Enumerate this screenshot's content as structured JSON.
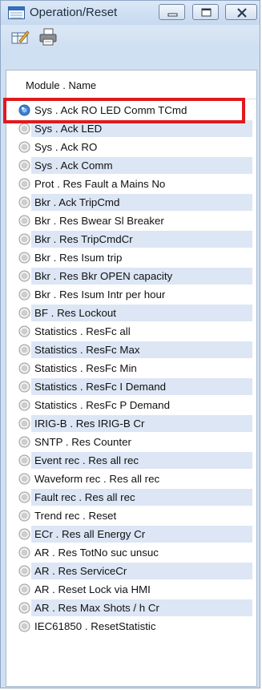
{
  "window": {
    "title": "Operation/Reset"
  },
  "colors": {
    "highlight": "#e0191e",
    "row_band": "#dce6f5",
    "selected_radio": "#3c7fd0"
  },
  "list": {
    "header": "Module . Name",
    "items": [
      "Sys . Ack RO LED Comm TCmd",
      "Sys . Ack LED",
      "Sys . Ack RO",
      "Sys . Ack Comm",
      "Prot . Res Fault a Mains No",
      "Bkr . Ack TripCmd",
      "Bkr . Res Bwear Sl Breaker",
      "Bkr . Res TripCmdCr",
      "Bkr . Res Isum trip",
      "Bkr . Res Bkr OPEN capacity",
      "Bkr . Res Isum Intr per hour",
      "BF . Res Lockout",
      "Statistics . ResFc all",
      "Statistics . ResFc Max",
      "Statistics . ResFc Min",
      "Statistics . ResFc I Demand",
      "Statistics . ResFc P Demand",
      "IRIG-B . Res IRIG-B Cr",
      "SNTP . Res Counter",
      "Event rec . Res all rec",
      "Waveform rec . Res all rec",
      "Fault rec . Res all rec",
      "Trend rec . Reset",
      "ECr . Res all Energy Cr",
      "AR . Res TotNo suc unsuc",
      "AR . Res ServiceCr",
      "AR . Reset Lock via HMI",
      "AR . Res Max Shots / h Cr",
      "IEC61850 . ResetStatistic"
    ]
  }
}
